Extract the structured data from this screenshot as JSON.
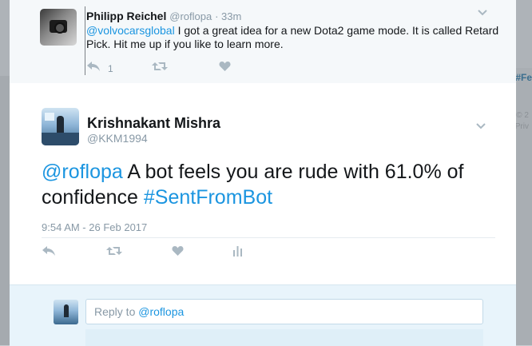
{
  "parent_tweet": {
    "name": "Philipp Reichel",
    "handle": "@roflopa",
    "time": "· 33m",
    "mention": "@volvocarsglobal",
    "text": " I got a great idea for a new Dota2 game mode. It is called Retard Pick. Hit me up if you like to learn more.",
    "reply_count": "1",
    "icons": [
      "reply-icon",
      "retweet-icon",
      "like-icon",
      "chevron-down-icon"
    ]
  },
  "main_tweet": {
    "name": "Krishnakant Mishra",
    "handle": "@KKM1994",
    "mention": "@roflopa",
    "text": " A bot feels you are rude with 61.0% of confidence ",
    "hashtag": "#SentFromBot",
    "date": "9:54 AM - 26 Feb 2017",
    "icons": [
      "reply-icon",
      "retweet-icon",
      "like-icon",
      "analytics-icon",
      "chevron-down-icon"
    ]
  },
  "reply_box": {
    "placeholder_prefix": "Reply to ",
    "placeholder_mention": "@roflopa"
  },
  "background": {
    "right_tag": "#Fe",
    "right_meta_1": "© 2",
    "right_meta_2": "Priv"
  },
  "colors": {
    "link": "#1b95e0",
    "text": "#14171a",
    "muted": "#8899a6",
    "reply_bar": "#e8f4fb"
  }
}
